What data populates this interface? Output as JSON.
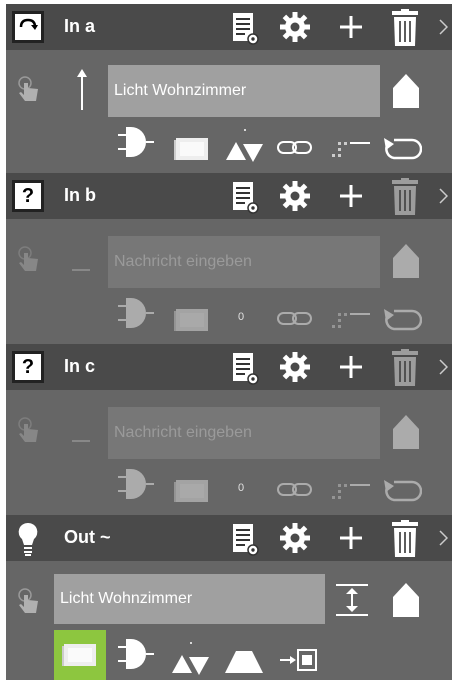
{
  "blocks": [
    {
      "title": "In a",
      "type_icon": "arrow-curve-icon",
      "field": {
        "value": "Licht Wohnzimmer",
        "placeholder": ""
      }
    },
    {
      "title": "In b",
      "type_icon": "question-icon",
      "type_symbol": "?",
      "field": {
        "value": "",
        "placeholder": "Nachricht eingeben"
      },
      "counter": "0"
    },
    {
      "title": "In c",
      "type_icon": "question-icon",
      "type_symbol": "?",
      "field": {
        "value": "",
        "placeholder": "Nachricht eingeben"
      },
      "counter": "0"
    },
    {
      "title": "Out ~",
      "type_icon": "lightbulb-icon",
      "field": {
        "value": "Licht Wohnzimmer",
        "placeholder": ""
      }
    }
  ],
  "colors": {
    "header_bg": "#4a4a4a",
    "section_bg": "#666666",
    "field_bg": "#a0a0a0",
    "active_toggle": "#8dc63f",
    "icon": "#ffffff"
  },
  "icons": {
    "header": [
      "document-settings-icon",
      "gear-icon",
      "plus-icon",
      "trash-icon",
      "chevron-right-icon"
    ],
    "input_row": [
      "touch-hand-icon",
      "direction-arrow-icon",
      "home-icon"
    ],
    "toolbar_in": [
      "and-gate-icon",
      "device-box-icon",
      "up-down-triangles-icon",
      "link-icon",
      "dotted-line-icon",
      "loop-arrow-icon"
    ],
    "toolbar_out": [
      "device-box-icon",
      "and-gate-icon",
      "up-down-triangles-icon",
      "bell-curve-icon",
      "export-device-icon"
    ],
    "out_extra": [
      "range-arrows-icon"
    ]
  }
}
